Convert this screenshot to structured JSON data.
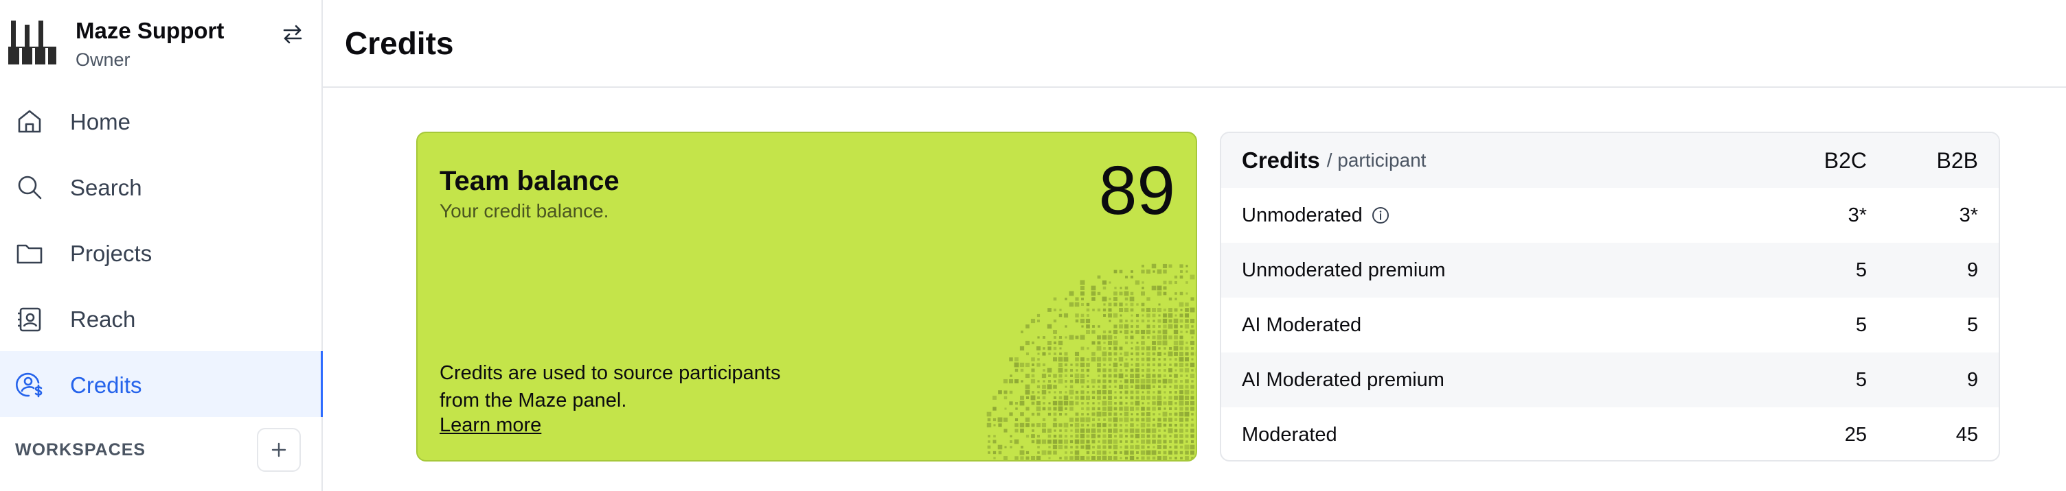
{
  "sidebar": {
    "org_name": "Maze Support",
    "org_role": "Owner",
    "nav": [
      {
        "label": "Home",
        "icon": "home-icon",
        "active": false
      },
      {
        "label": "Search",
        "icon": "search-icon",
        "active": false
      },
      {
        "label": "Projects",
        "icon": "folder-icon",
        "active": false
      },
      {
        "label": "Reach",
        "icon": "contacts-icon",
        "active": false
      },
      {
        "label": "Credits",
        "icon": "credits-icon",
        "active": true
      }
    ],
    "workspaces_label": "WORKSPACES"
  },
  "header": {
    "title": "Credits"
  },
  "balance": {
    "title": "Team balance",
    "subtitle": "Your credit balance.",
    "value": "89",
    "description": "Credits are used to source participants from the Maze panel.",
    "link": "Learn more"
  },
  "pricing": {
    "title": "Credits",
    "unit": "/ participant",
    "col_b2c": "B2C",
    "col_b2b": "B2B",
    "rows": [
      {
        "name": "Unmoderated",
        "b2c": "3*",
        "b2b": "3*",
        "info": true
      },
      {
        "name": "Unmoderated premium",
        "b2c": "5",
        "b2b": "9"
      },
      {
        "name": "AI Moderated",
        "b2c": "5",
        "b2b": "5"
      },
      {
        "name": "AI Moderated premium",
        "b2c": "5",
        "b2b": "9"
      },
      {
        "name": "Moderated",
        "b2c": "25",
        "b2b": "45"
      }
    ]
  },
  "colors": {
    "accent": "#2563eb",
    "card_green": "#c4e44a",
    "pattern": "#8fa935"
  }
}
